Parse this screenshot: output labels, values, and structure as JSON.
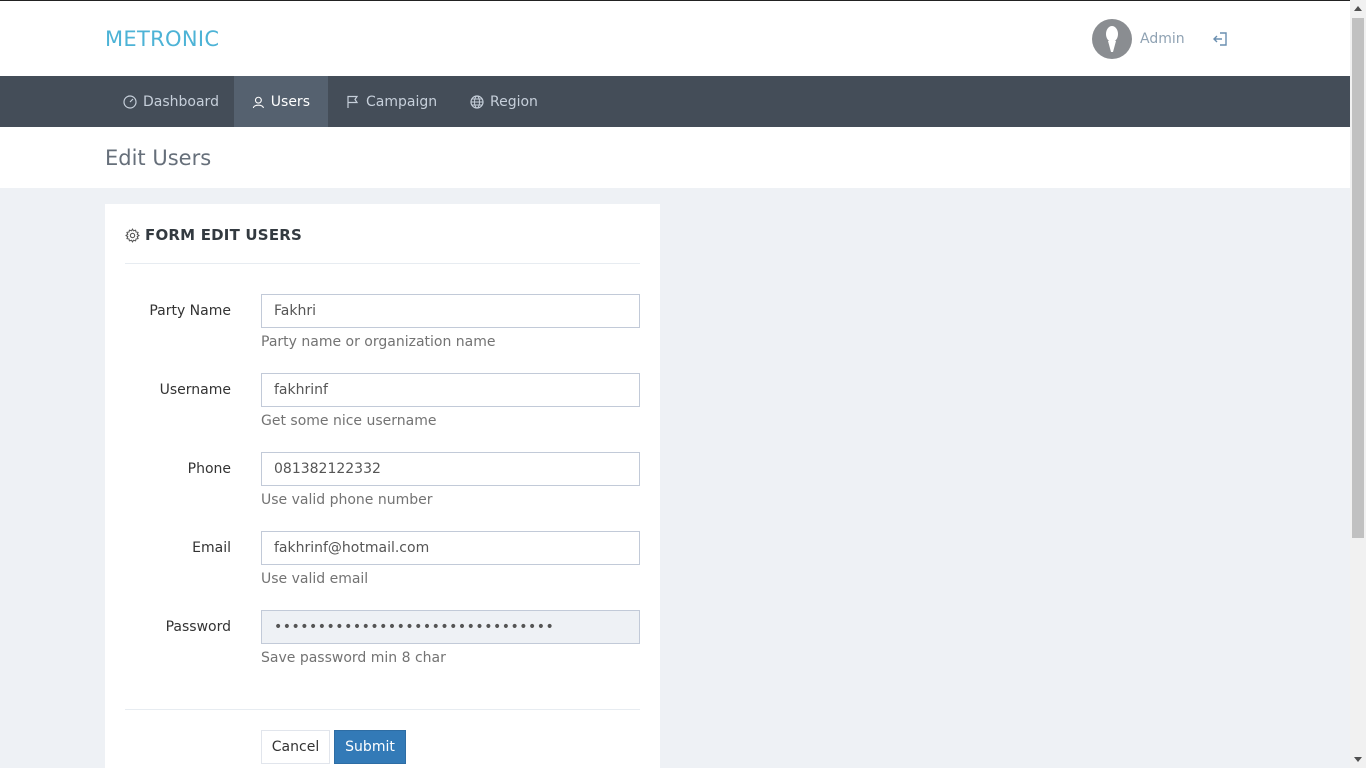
{
  "header": {
    "logo": "METRONIC",
    "user_name": "Admin",
    "icons": {
      "avatar": "avatar-silhouette",
      "logout": "logout-icon"
    }
  },
  "nav": {
    "items": [
      {
        "label": "Dashboard",
        "icon": "dashboard-icon"
      },
      {
        "label": "Users",
        "icon": "user-icon",
        "active": true
      },
      {
        "label": "Campaign",
        "icon": "flag-icon"
      },
      {
        "label": "Region",
        "icon": "globe-icon"
      }
    ]
  },
  "page": {
    "title": "Edit Users"
  },
  "form": {
    "title": "FORM EDIT USERS",
    "fields": [
      {
        "label": "Party Name",
        "value": "Fakhri",
        "help": "Party name or organization name"
      },
      {
        "label": "Username",
        "value": "fakhrinf",
        "help": "Get some nice username"
      },
      {
        "label": "Phone",
        "value": "081382122332",
        "help": "Use valid phone number"
      },
      {
        "label": "Email",
        "value": "fakhrinf@hotmail.com",
        "help": "Use valid email"
      },
      {
        "label": "Password",
        "value": "••••••••••••••••••••••••••••••••",
        "help": "Save password min 8 char"
      }
    ],
    "cancel_label": "Cancel",
    "submit_label": "Submit"
  },
  "colors": {
    "logo": "#4db3d6",
    "navbar": "#444d58",
    "nav_active": "#55616f",
    "primary": "#337ab7",
    "background": "#eef1f5"
  }
}
